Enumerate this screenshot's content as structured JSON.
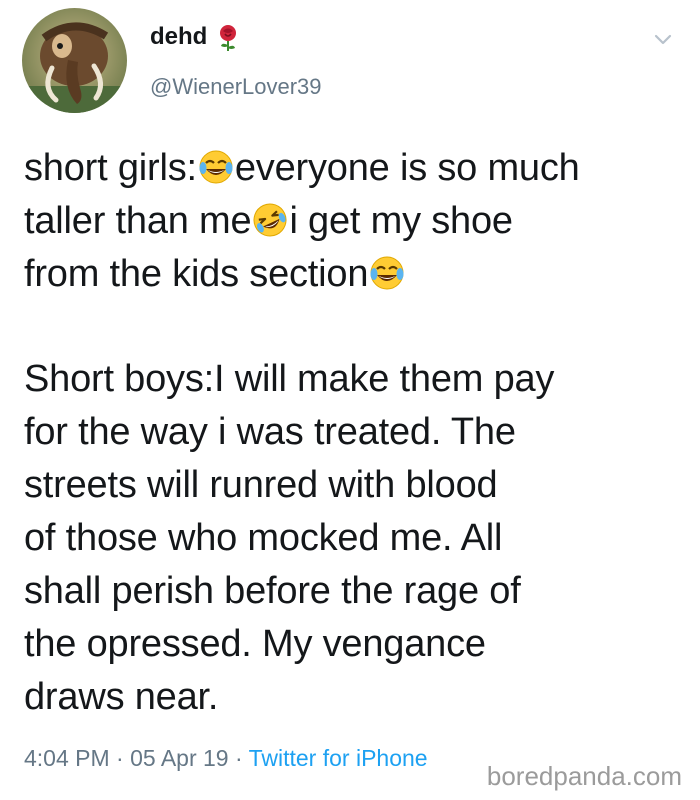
{
  "user": {
    "display_name": "dehd",
    "handle": "@WienerLover39",
    "avatar": "mammoth-avatar",
    "badge_icon": "rose-icon"
  },
  "menu_icon": "chevron-down-icon",
  "tweet": {
    "lines": [
      {
        "before": "short girls:",
        "emoji": "tears-of-joy",
        "after": "everyone is so much"
      },
      {
        "before": "taller than me",
        "emoji": "rolling-laughing",
        "after": "i get my shoe"
      },
      {
        "before": "from the kids section",
        "emoji": "tears-of-joy",
        "after": ""
      },
      {
        "text": "Short boys:I will make them pay"
      },
      {
        "text": "for the way i was treated. The"
      },
      {
        "text": "streets will runred with blood"
      },
      {
        "text": "of those who mocked me. All"
      },
      {
        "text": "shall perish before the rage of"
      },
      {
        "text": "the opressed. My vengance"
      },
      {
        "text": "draws near."
      }
    ]
  },
  "meta": {
    "time": "4:04 PM",
    "separator": " · ",
    "date": "05 Apr 19",
    "source": "Twitter for iPhone"
  },
  "watermark": "boredpanda.com",
  "colors": {
    "text": "#14171a",
    "secondary": "#657786",
    "link": "#1da1f2"
  }
}
